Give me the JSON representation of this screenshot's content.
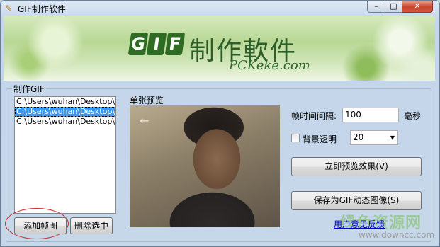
{
  "window": {
    "title": "GIF制作软件",
    "minimize": "–",
    "maximize": "□",
    "close": "✕",
    "app_icon": "pen-icon"
  },
  "banner": {
    "logo_letters": [
      "G",
      "I",
      "F"
    ],
    "logo_text": "制作軟件",
    "url": "PCKeke.com"
  },
  "group": {
    "label": "制作GIF"
  },
  "file_list": {
    "items": [
      {
        "text": "C:\\Users\\wuhan\\Desktop\\图",
        "selected": false
      },
      {
        "text": "C:\\Users\\wuhan\\Desktop\\图",
        "selected": true
      },
      {
        "text": "C:\\Users\\wuhan\\Desktop\\图",
        "selected": false
      }
    ]
  },
  "buttons": {
    "add_frame": "添加帧图",
    "delete_selected": "删除选中",
    "preview_now": "立即预览效果(V)",
    "save_gif": "保存为GIF动态图像(S)"
  },
  "preview": {
    "label": "单张预览",
    "arrow": "←"
  },
  "settings": {
    "interval_label": "帧时间间隔:",
    "interval_value": "100",
    "interval_unit": "毫秒",
    "transparent_label": "背景透明",
    "transparent_checked": false,
    "transparent_value": "20"
  },
  "feedback_link": "用户意见反馈",
  "watermark": {
    "text": "绿色资源网",
    "url": "www.downcc.com"
  }
}
